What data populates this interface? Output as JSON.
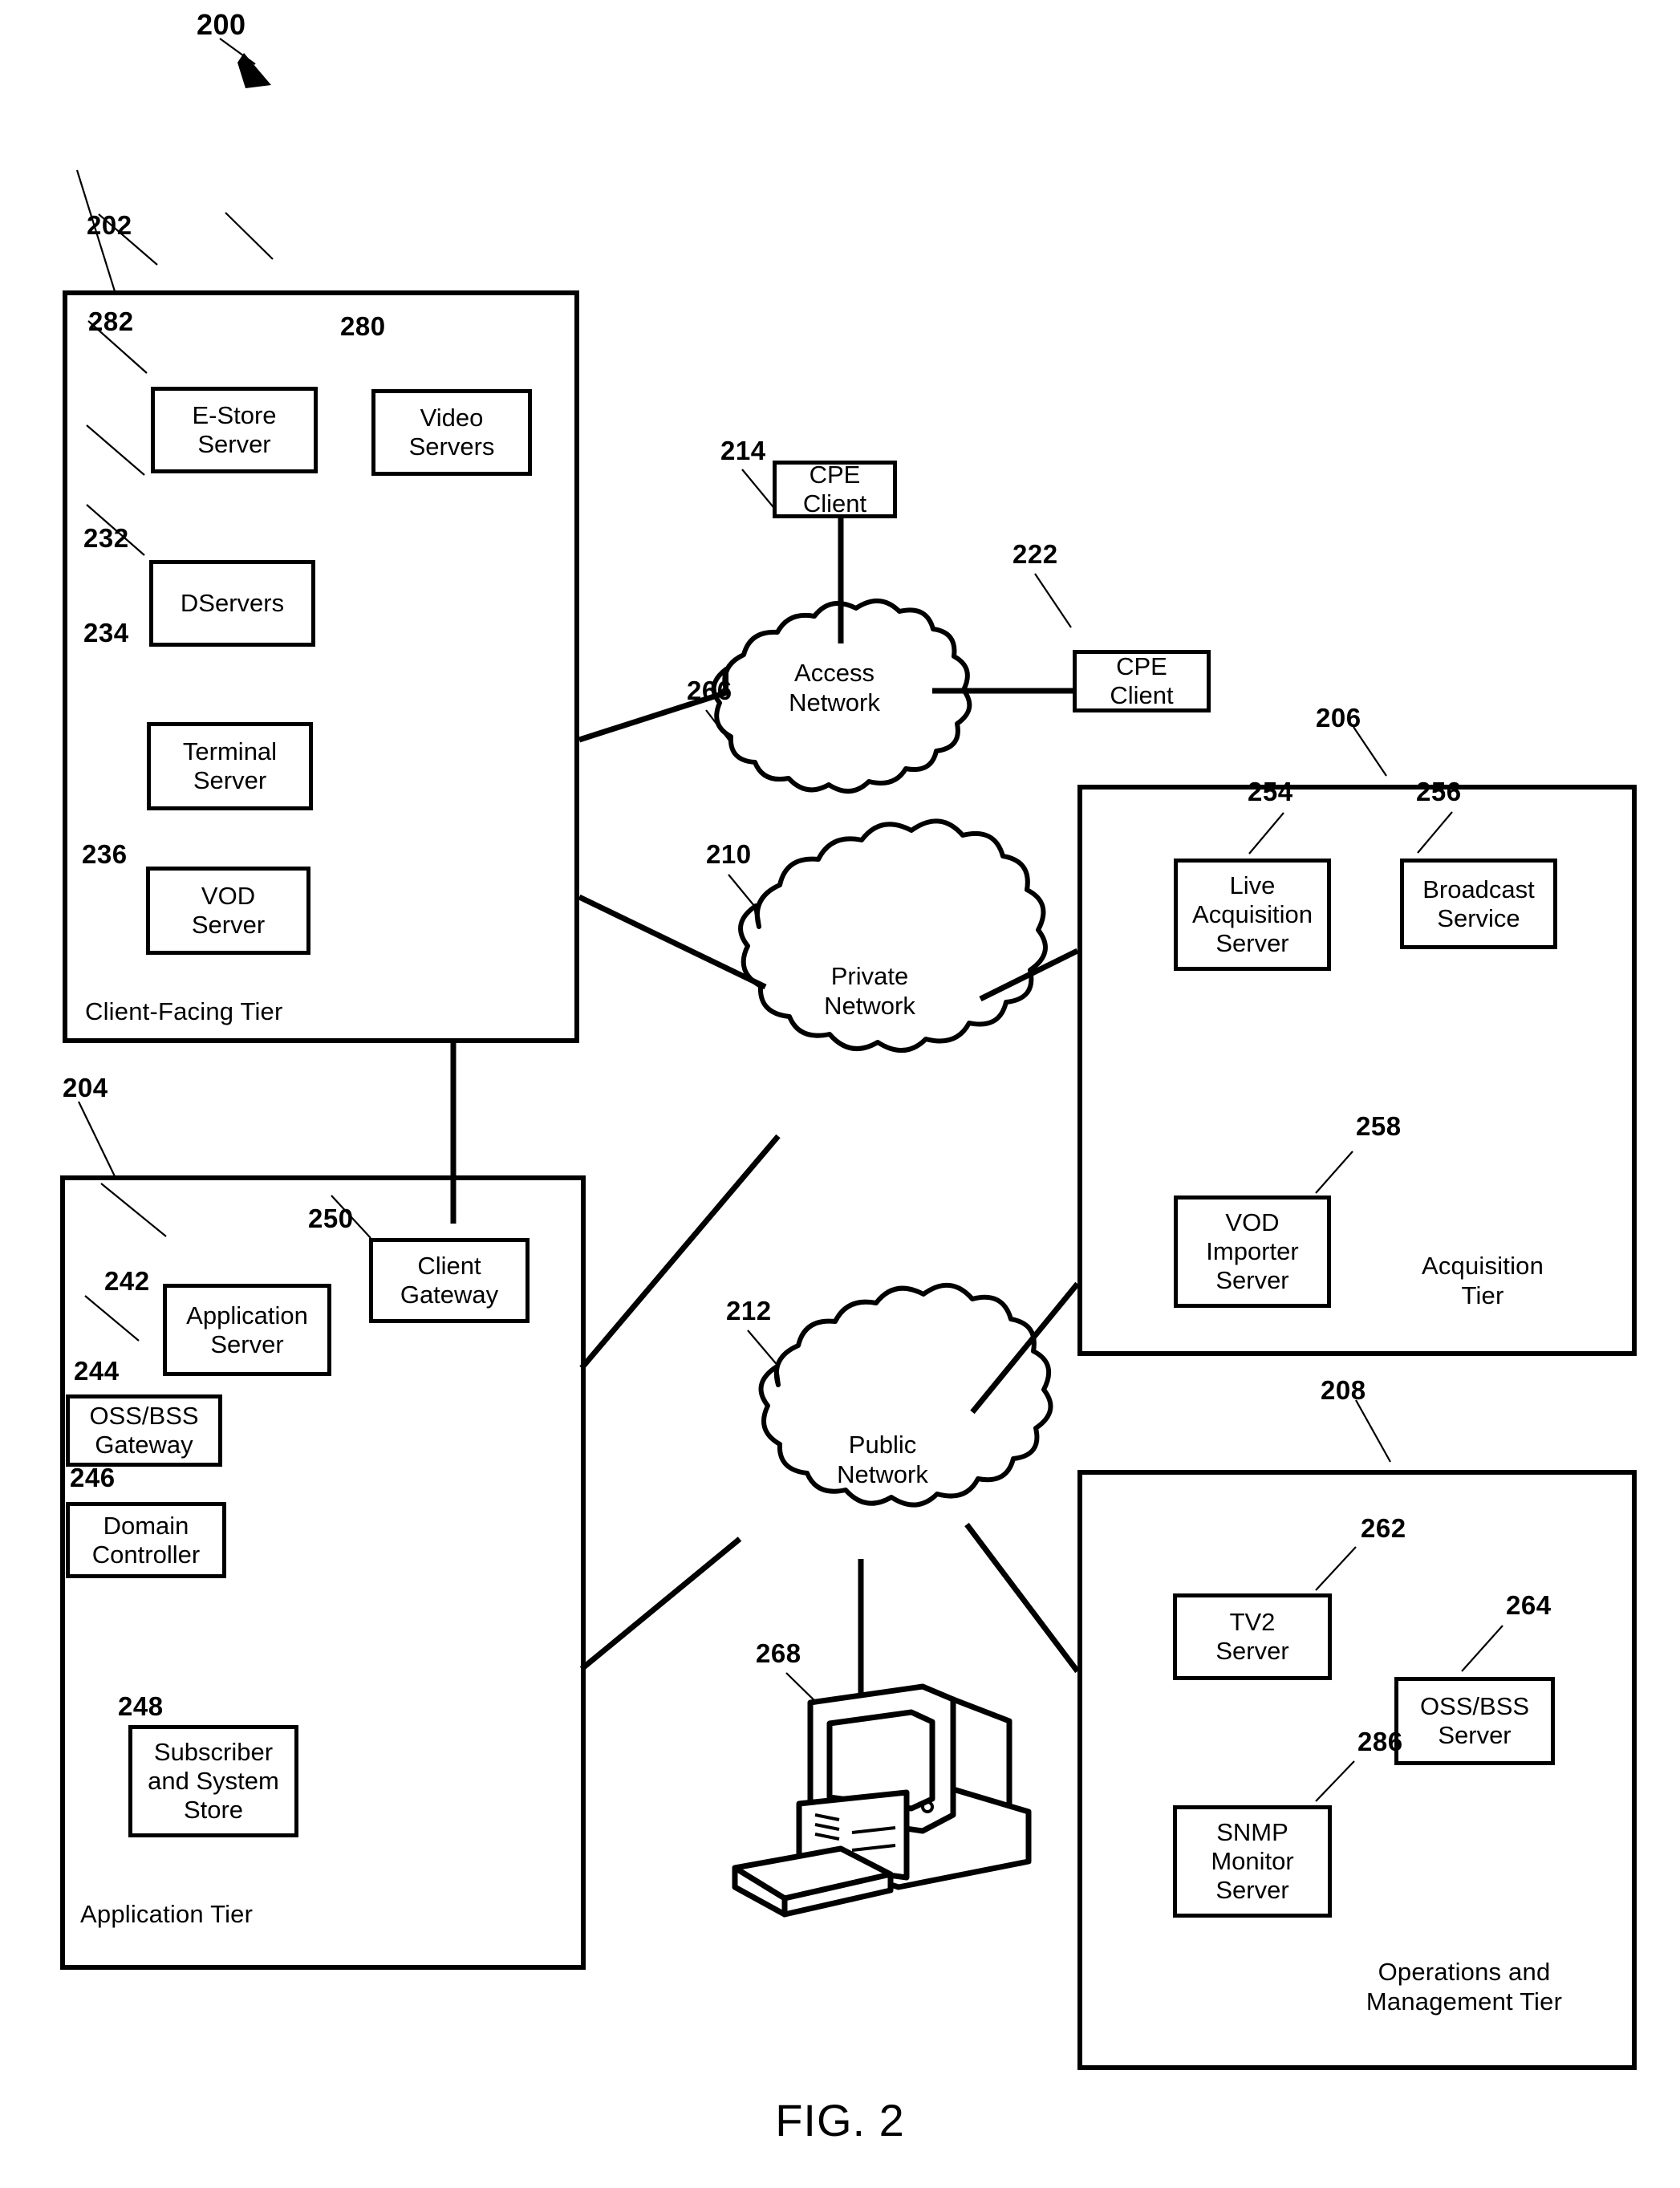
{
  "figure": {
    "caption": "FIG. 2",
    "system_ref": "200"
  },
  "tiers": [
    {
      "ref": "202",
      "label": "Client-Facing Tier",
      "components": [
        {
          "ref": "282",
          "label": "E-Store\nServer"
        },
        {
          "ref": "280",
          "label": "Video\nServers"
        },
        {
          "ref": "232",
          "label": "DServers"
        },
        {
          "ref": "234",
          "label": "Terminal\nServer"
        },
        {
          "ref": "236",
          "label": "VOD\nServer"
        }
      ]
    },
    {
      "ref": "204",
      "label": "Application Tier",
      "components": [
        {
          "ref": "250",
          "label": "Client\nGateway"
        },
        {
          "ref": "242",
          "label": "Application\nServer"
        },
        {
          "ref": "244",
          "label": "OSS/BSS\nGateway"
        },
        {
          "ref": "246",
          "label": "Domain\nController"
        },
        {
          "ref": "248",
          "label": "Subscriber\nand System\nStore"
        }
      ]
    },
    {
      "ref": "206",
      "label": "Acquisition\nTier",
      "components": [
        {
          "ref": "254",
          "label": "Live\nAcquisition\nServer"
        },
        {
          "ref": "256",
          "label": "Broadcast\nService"
        },
        {
          "ref": "258",
          "label": "VOD\nImporter\nServer"
        }
      ]
    },
    {
      "ref": "208",
      "label": "Operations and\nManagement Tier",
      "components": [
        {
          "ref": "262",
          "label": "TV2\nServer"
        },
        {
          "ref": "264",
          "label": "OSS/BSS\nServer"
        },
        {
          "ref": "286",
          "label": "SNMP\nMonitor\nServer"
        }
      ]
    }
  ],
  "networks": [
    {
      "ref": "266",
      "label": "Access\nNetwork"
    },
    {
      "ref": "210",
      "label": "Private\nNetwork"
    },
    {
      "ref": "212",
      "label": "Public\nNetwork"
    }
  ],
  "clients": [
    {
      "ref": "214",
      "label": "CPE\nClient"
    },
    {
      "ref": "222",
      "label": "CPE\nClient"
    }
  ],
  "workstation": {
    "ref": "268",
    "icon": "desktop-computer-icon"
  },
  "colors": {
    "line": "#000000",
    "background": "#ffffff"
  }
}
